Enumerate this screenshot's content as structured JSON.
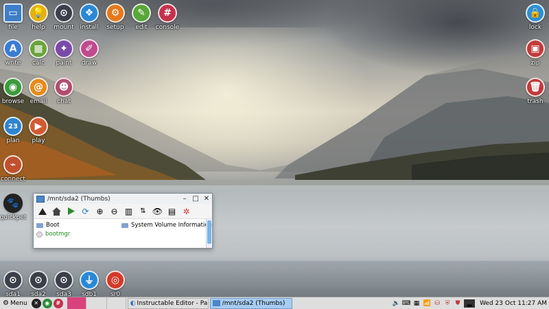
{
  "desktop": {
    "left_icons": [
      {
        "label": "file",
        "icon": "folder-icon",
        "color": "#3f7fc8"
      },
      {
        "label": "help",
        "icon": "lightbulb-icon",
        "color": "#e4b012"
      },
      {
        "label": "mount",
        "icon": "drive-toggle-icon",
        "color": "#3b3f4a"
      },
      {
        "label": "install",
        "icon": "package-icon",
        "color": "#2a88d6"
      },
      {
        "label": "setup",
        "icon": "gear-icon",
        "color": "#e5781c"
      },
      {
        "label": "edit",
        "icon": "document-edit-icon",
        "color": "#5aa63a"
      },
      {
        "label": "console",
        "icon": "hash-console-icon",
        "color": "#c4314b"
      },
      {
        "label": "write",
        "icon": "write-icon",
        "color": "#3a7cd4"
      },
      {
        "label": "calc",
        "icon": "calculator-icon",
        "color": "#6aa33c"
      },
      {
        "label": "paint",
        "icon": "palette-icon",
        "color": "#7a4aa8"
      },
      {
        "label": "draw",
        "icon": "draw-icon",
        "color": "#c04a8e"
      },
      {
        "label": "browse",
        "icon": "globe-icon",
        "color": "#3c9a3c"
      },
      {
        "label": "email",
        "icon": "at-icon",
        "color": "#e68a1c"
      },
      {
        "label": "chat",
        "icon": "chat-icon",
        "color": "#b04c6c"
      },
      {
        "label": "plan",
        "icon": "calendar-icon",
        "color": "#2f84cf"
      },
      {
        "label": "play",
        "icon": "media-play-icon",
        "color": "#d15a32"
      },
      {
        "label": "connect",
        "icon": "network-icon",
        "color": "#c1502e"
      },
      {
        "label": "quickpet",
        "icon": "dog-icon",
        "color": "#222222"
      }
    ],
    "right_icons": [
      {
        "label": "lock",
        "icon": "lock-icon",
        "color": "#2c8fd6"
      },
      {
        "label": "zip",
        "icon": "zip-icon",
        "color": "#c23a3a"
      },
      {
        "label": "trash",
        "icon": "trash-icon",
        "color": "#c23a3a"
      }
    ],
    "drive_icons": [
      {
        "label": "sda1",
        "icon": "drive-toggle-icon",
        "color": "#3b3f4a"
      },
      {
        "label": "sda2",
        "icon": "drive-toggle-icon",
        "color": "#3b3f4a"
      },
      {
        "label": "sda3",
        "icon": "drive-toggle-icon",
        "color": "#3b3f4a"
      },
      {
        "label": "sdb1",
        "icon": "usb-icon",
        "color": "#2a88d6"
      },
      {
        "label": "sr0",
        "icon": "optical-disc-icon",
        "color": "#d23a2a"
      }
    ]
  },
  "window": {
    "title": "/mnt/sda2 (Thumbs)",
    "controls": {
      "minimize": "–",
      "maximize": "□",
      "close": "✕"
    },
    "toolbar": [
      "up-arrow-icon",
      "home-icon",
      "go-icon",
      "refresh-icon",
      "zoom-in-icon",
      "zoom-out-icon",
      "grid-view-icon",
      "sort-icon",
      "eye-icon",
      "list-view-icon",
      "help-icon"
    ],
    "files": [
      {
        "name": "Boot",
        "type": "folder"
      },
      {
        "name": "System Volume Information",
        "type": "folder"
      },
      {
        "name": "bootmgr",
        "type": "file"
      }
    ]
  },
  "taskbar": {
    "menu_label": "Menu",
    "tasks": [
      {
        "label": "Instructable Editor - Pale M",
        "active": false
      },
      {
        "label": "/mnt/sda2 (Thumbs)",
        "active": true
      }
    ],
    "clock": "Wed 23 Oct 11:27 AM",
    "accent_pager": "#c34068"
  }
}
